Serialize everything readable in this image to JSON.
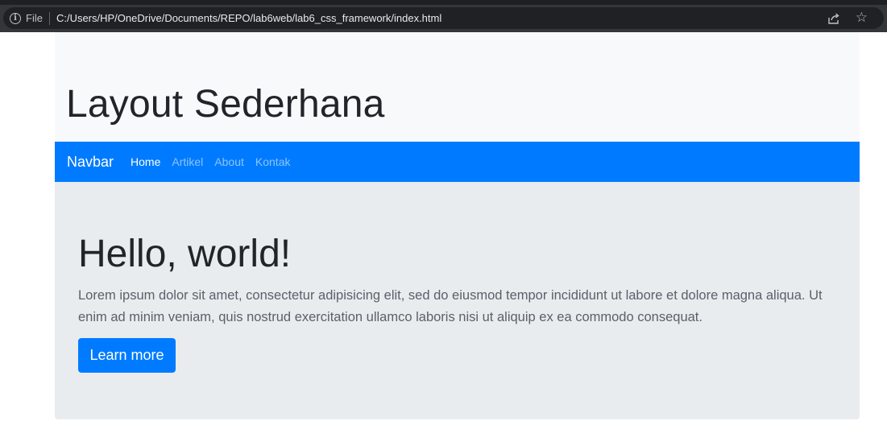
{
  "browser": {
    "file_label": "File",
    "url": "C:/Users/HP/OneDrive/Documents/REPO/lab6web/lab6_css_framework/index.html",
    "icons": [
      "info-icon",
      "share-icon",
      "star-icon"
    ]
  },
  "page": {
    "header_title": "Layout Sederhana",
    "navbar": {
      "brand": "Navbar",
      "links": [
        {
          "label": "Home",
          "active": true
        },
        {
          "label": "Artikel",
          "active": false
        },
        {
          "label": "About",
          "active": false
        },
        {
          "label": "Kontak",
          "active": false
        }
      ]
    },
    "jumbotron": {
      "title": "Hello, world!",
      "lead": "Lorem ipsum dolor sit amet, consectetur adipisicing elit, sed do eiusmod tempor incididunt ut labore et dolore magna aliqua. Ut enim ad minim veniam, quis nostrud exercitation ullamco laboris nisi ut aliquip ex ea commodo consequat.",
      "button_label": "Learn more"
    }
  },
  "colors": {
    "primary": "#007bff",
    "header_bg": "#f8f9fa",
    "jumbotron_bg": "#e9ecef",
    "text_dark": "#212529"
  }
}
